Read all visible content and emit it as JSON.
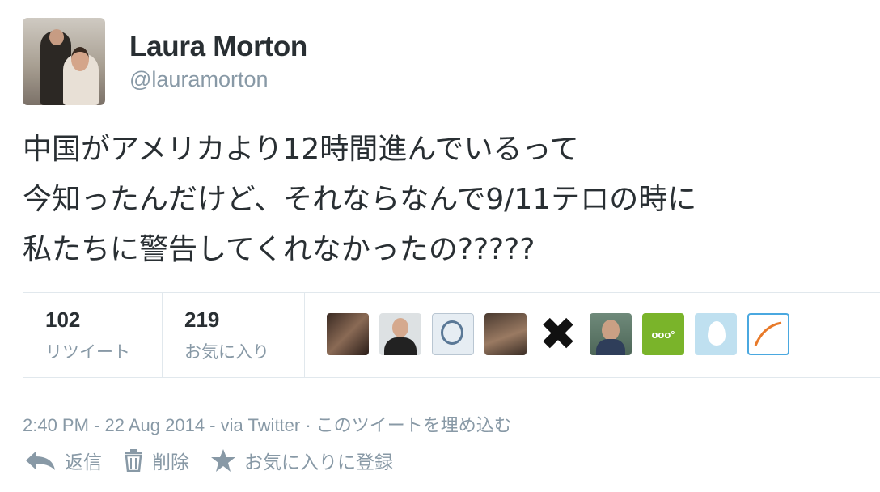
{
  "author": {
    "name": "Laura Morton",
    "handle": "@lauramorton"
  },
  "tweet": {
    "lines": [
      "中国がアメリカより12時間進んでいるって",
      "今知ったんだけど、それならなんで9/11テロの時に",
      "私たちに警告してくれなかったの?????"
    ]
  },
  "stats": {
    "retweets_count": "102",
    "retweets_label": "リツイート",
    "favorites_count": "219",
    "favorites_label": "お気に入り"
  },
  "favoriters": [
    {
      "icon": "user-avatar-1"
    },
    {
      "icon": "user-avatar-2"
    },
    {
      "icon": "user-avatar-3"
    },
    {
      "icon": "user-avatar-4"
    },
    {
      "icon": "user-avatar-5",
      "glyph": "✖"
    },
    {
      "icon": "user-avatar-6"
    },
    {
      "icon": "user-avatar-7",
      "text": "ooo°"
    },
    {
      "icon": "egg-avatar"
    },
    {
      "icon": "user-avatar-9"
    }
  ],
  "meta": {
    "time": "2:40 PM - 22 Aug 2014 - via Twitter",
    "separator": " · ",
    "embed_label": "このツイートを埋め込む"
  },
  "actions": {
    "reply_label": "返信",
    "delete_label": "削除",
    "favorite_label": "お気に入りに登録"
  },
  "colors": {
    "text": "#292f33",
    "muted": "#8899a6",
    "divider": "#e1e8ed"
  }
}
